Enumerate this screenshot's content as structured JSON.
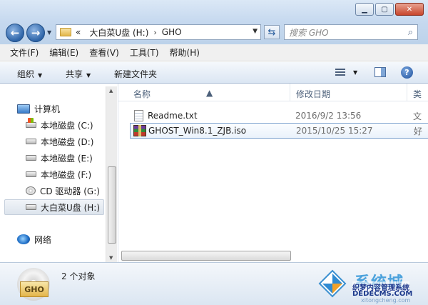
{
  "window": {
    "minimize_glyph": "▁",
    "maximize_glyph": "▢",
    "close_glyph": "✕"
  },
  "address": {
    "chevrons": "«",
    "crumbs": [
      "大白菜U盘 (H:)",
      "GHO"
    ],
    "separator": "›",
    "search_placeholder": "搜索 GHO"
  },
  "menu": [
    "文件(F)",
    "编辑(E)",
    "查看(V)",
    "工具(T)",
    "帮助(H)"
  ],
  "toolbar": {
    "organize": "组织",
    "share": "共享",
    "new_folder": "新建文件夹",
    "help": "?"
  },
  "nav": {
    "computer": "计算机",
    "drives": [
      {
        "label": "本地磁盘 (C:)",
        "kind": "sys"
      },
      {
        "label": "本地磁盘 (D:)",
        "kind": "hdd"
      },
      {
        "label": "本地磁盘 (E:)",
        "kind": "hdd"
      },
      {
        "label": "本地磁盘 (F:)",
        "kind": "hdd"
      },
      {
        "label": "CD 驱动器 (G:)",
        "kind": "cd"
      },
      {
        "label": "大白菜U盘 (H:)",
        "kind": "usb"
      }
    ],
    "selected_index": 5,
    "network": "网络"
  },
  "columns": {
    "name": "名称",
    "date": "修改日期",
    "type": "类"
  },
  "files": [
    {
      "name": "Readme.txt",
      "date": "2016/9/2 13:56",
      "type": "文",
      "icon": "text-file-icon"
    },
    {
      "name": "GHOST_Win8.1_ZJB.iso",
      "date": "2015/10/25 15:27",
      "type": "好",
      "icon": "rar-archive-icon"
    }
  ],
  "details": {
    "icon_label": "GHO",
    "count": "2 个对象"
  },
  "watermark": {
    "big": "系统城",
    "small": "织梦内容管理系统",
    "url": "DEDECMS.COM",
    "url2": "xitongcheng.com"
  }
}
